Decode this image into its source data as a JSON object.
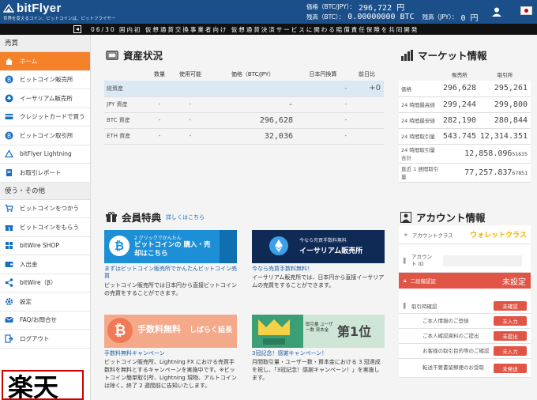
{
  "header": {
    "logo_text": "bitFlyer",
    "tagline": "世界を変えるコイン、ビットコインは、ビットフライヤー",
    "price_label": "価格（BTC/JPY）：",
    "price_value": "296,722 円",
    "btc_balance_label": "残高（BTC）：",
    "btc_balance_value": "0.00000000 BTC",
    "jpy_balance_label": "残高（JPY）：",
    "jpy_balance_value": "0 円"
  },
  "ticker": {
    "text": "06/30 国内初 仮想通貨交換事業者向け 仮想通貨決済サービスに関わる賠償責任保険を共同開発"
  },
  "sidebar": {
    "section1": "売買",
    "items1": [
      {
        "label": "ホーム",
        "icon": "home-icon"
      },
      {
        "label": "ビットコイン販売所",
        "icon": "bitcoin-icon"
      },
      {
        "label": "イーサリアム販売所",
        "icon": "ethereum-icon"
      },
      {
        "label": "クレジットカードで買う",
        "icon": "credit-card-icon"
      },
      {
        "label": "ビットコイン取引所",
        "icon": "bitcoin-icon"
      },
      {
        "label": "bitFlyer Lightning",
        "icon": "lightning-icon"
      },
      {
        "label": "お取引レポート",
        "icon": "report-icon"
      }
    ],
    "section2": "使う・その他",
    "items2": [
      {
        "label": "ビットコインをつかう",
        "icon": "cart-icon"
      },
      {
        "label": "ビットコインをもらう",
        "icon": "gift-icon"
      },
      {
        "label": "bitWire SHOP",
        "icon": "shop-icon"
      },
      {
        "label": "入出金",
        "icon": "wallet-icon"
      },
      {
        "label": "bitWire（β）",
        "icon": "share-icon"
      },
      {
        "label": "設定",
        "icon": "gear-icon"
      },
      {
        "label": "FAQ/お問合せ",
        "icon": "mail-icon"
      },
      {
        "label": "ログアウト",
        "icon": "logout-icon"
      }
    ],
    "ad_text": "楽天"
  },
  "assets": {
    "title": "資産状況",
    "headers": [
      "",
      "数量",
      "使用可能",
      "価格（BTC/JPY）",
      "日本円換算",
      "前日比"
    ],
    "rows": [
      [
        "総資産",
        "",
        "",
        "",
        "-",
        "+0"
      ],
      [
        "JPY 資産",
        "-",
        "-",
        "-",
        "-",
        ""
      ],
      [
        "BTC 資産",
        "-",
        "-",
        "296,628",
        "-",
        ""
      ],
      [
        "ETH 資産",
        "-",
        "-",
        "32,036",
        "-",
        ""
      ]
    ]
  },
  "market": {
    "title": "マーケット情報",
    "headers": [
      "",
      "販売所",
      "取引所"
    ],
    "rows": [
      {
        "label": "価格",
        "a": "296,628",
        "b": "295,261"
      },
      {
        "label": "24 時間最高値",
        "a": "299,244",
        "b": "299,800"
      },
      {
        "label": "24 時間最安値",
        "a": "282,190",
        "b": "280,844"
      },
      {
        "label": "24 時間取引量",
        "a": "543.745",
        "b": "12,314.351"
      }
    ],
    "total24_label": "24 時間取引量合計",
    "total24_value": "12,858.096",
    "total24_small": "51635",
    "week_label": "直近 1 週間取引量",
    "week_value": "77,257.837",
    "week_small": "67851"
  },
  "benefits": {
    "title": "会員特典",
    "link": "詳しくはこちら",
    "cards": [
      {
        "banner_small": "2 クリックでかんたん",
        "banner_main": "ビットコインの 購入・売却はこちら",
        "title": "まずはビットコイン販売所でかんたんビットコイン売買",
        "body": "ビットコイン販売所では日本円から直接ビットコインの売買をすることができます。"
      },
      {
        "banner_small": "今なら売買手数料無料",
        "banner_main": "イーサリアム販売所",
        "title": "今なら売買手数料無料！",
        "body": "イーサリアム販売所では、日本円から直接イーサリアムの売買をすることができます。"
      },
      {
        "banner_main": "手数料無料",
        "banner_sub": "しばらく延長",
        "title": "手数料無料キャンペーン",
        "body": "ビットコイン販売所、Lightning FX における売買手数料を無料とするキャンペーンを実施中です。※ビットコイン簡単取引所、Lightning 現物、アルトコインは除く。終了 2 週間前に告知いたします。"
      },
      {
        "banner_small": "取引量 ユーザー数 資本金",
        "banner_main": "第1位",
        "title": "3冠記念！感謝キャンペーン！",
        "body": "月間取引量・ユーザー数・資本金における 3 冠達成を祝し、「3冠記念！感謝キャンペーン！」を実施します。"
      }
    ]
  },
  "account": {
    "title": "アカウント情報",
    "class_label": "アカウントクラス",
    "class_value": "ウォレットクラス",
    "id_label": "アカウント ID",
    "twofa_label": "二段階認証",
    "twofa_value": "未設定",
    "confirm_label": "取引時確認",
    "confirm_status": "未確認",
    "steps": [
      {
        "label": "ご本人情報のご登録",
        "status": "未入力"
      },
      {
        "label": "ご本人確認資料のご提出",
        "status": "未提出"
      },
      {
        "label": "お客様の取引目的等のご確認",
        "status": "未入力"
      },
      {
        "label": "転送不要書留郵便のお受取",
        "status": "未発送"
      }
    ]
  },
  "colors": {
    "header": "#1a4f8a",
    "accent": "#f5822a",
    "alert": "#e05545",
    "link": "#1a6ec0"
  }
}
